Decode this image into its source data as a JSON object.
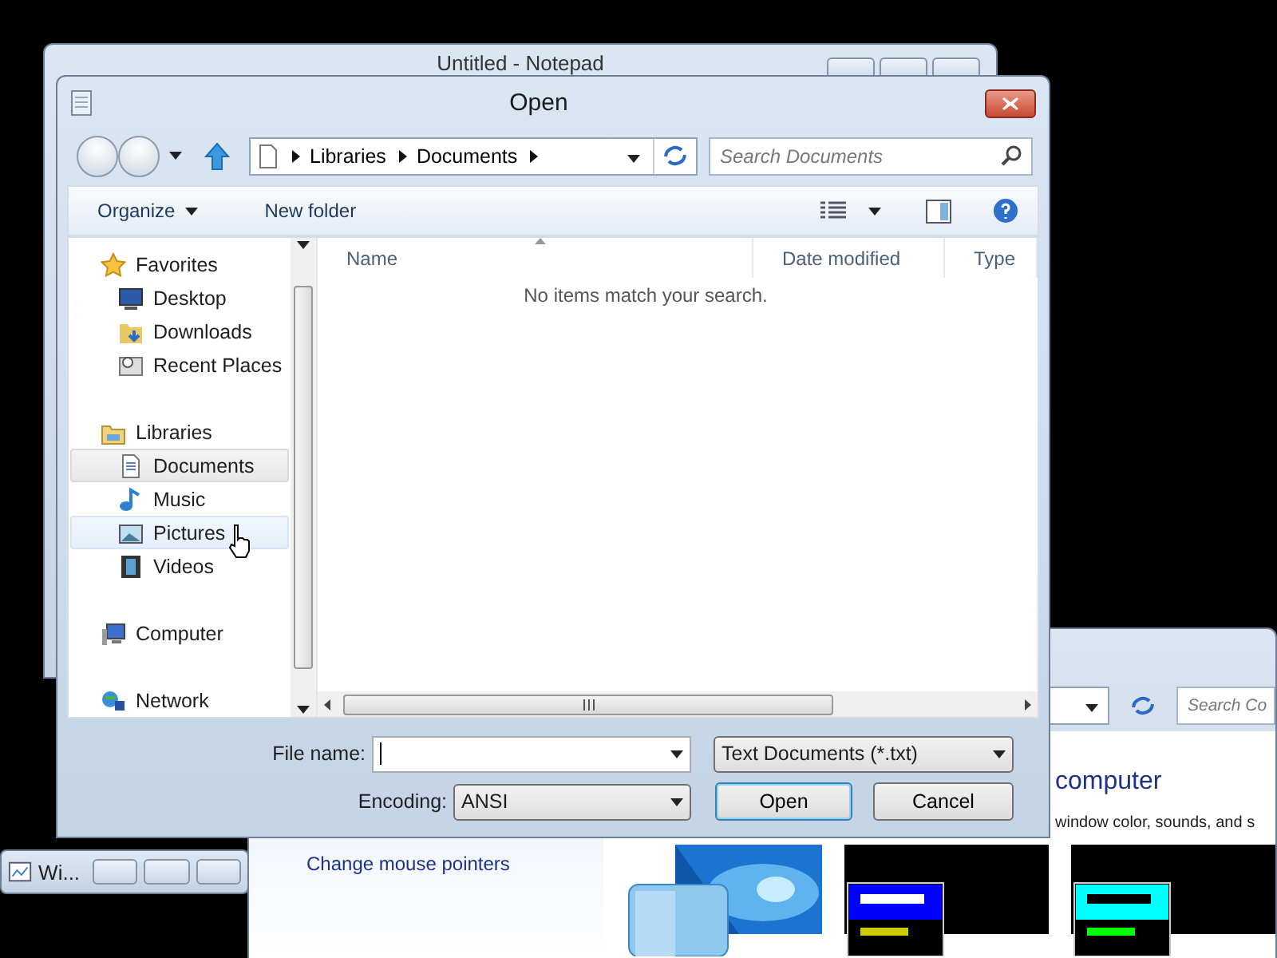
{
  "notepad": {
    "title": "Untitled - Notepad"
  },
  "dialog": {
    "title": "Open",
    "address": [
      "Libraries",
      "Documents"
    ],
    "search": {
      "placeholder": "Search Documents"
    },
    "toolbar": {
      "organize": "Organize",
      "new_folder": "New folder"
    },
    "nav": [
      {
        "label": "Favorites",
        "kind": "star",
        "selected": false,
        "hovered": false,
        "children": [
          {
            "label": "Desktop",
            "kind": "desktop",
            "selected": false,
            "hovered": false
          },
          {
            "label": "Downloads",
            "kind": "downloads",
            "selected": false,
            "hovered": false
          },
          {
            "label": "Recent Places",
            "kind": "recent",
            "selected": false,
            "hovered": false
          }
        ]
      },
      {
        "label": "Libraries",
        "kind": "libraries",
        "selected": false,
        "hovered": false,
        "children": [
          {
            "label": "Documents",
            "kind": "document",
            "selected": true,
            "hovered": false
          },
          {
            "label": "Music",
            "kind": "music",
            "selected": false,
            "hovered": false
          },
          {
            "label": "Pictures",
            "kind": "pictures",
            "selected": false,
            "hovered": true
          },
          {
            "label": "Videos",
            "kind": "videos",
            "selected": false,
            "hovered": false
          }
        ]
      },
      {
        "label": "Computer",
        "kind": "computer",
        "selected": false,
        "hovered": false
      },
      {
        "label": "Network",
        "kind": "network",
        "selected": false,
        "hovered": false
      }
    ],
    "columns": [
      {
        "label": "Name",
        "sorted": true
      },
      {
        "label": "Date modified",
        "sorted": false
      },
      {
        "label": "Type",
        "sorted": false
      }
    ],
    "empty_message": "No items match your search.",
    "file_name": {
      "label": "File name:"
    },
    "file_type": "Text Documents (*.txt)",
    "encoding": {
      "label": "Encoding:",
      "value": "ANSI"
    },
    "buttons": [
      {
        "label": "Open",
        "default": true
      },
      {
        "label": "Cancel",
        "default": false
      }
    ]
  },
  "background_window": {
    "search": {
      "placeholder": "Search Co"
    },
    "heading": "computer",
    "description": "window color, sounds, and s",
    "link": "Change mouse pointers"
  },
  "minimized_window": {
    "title": "Wi..."
  }
}
